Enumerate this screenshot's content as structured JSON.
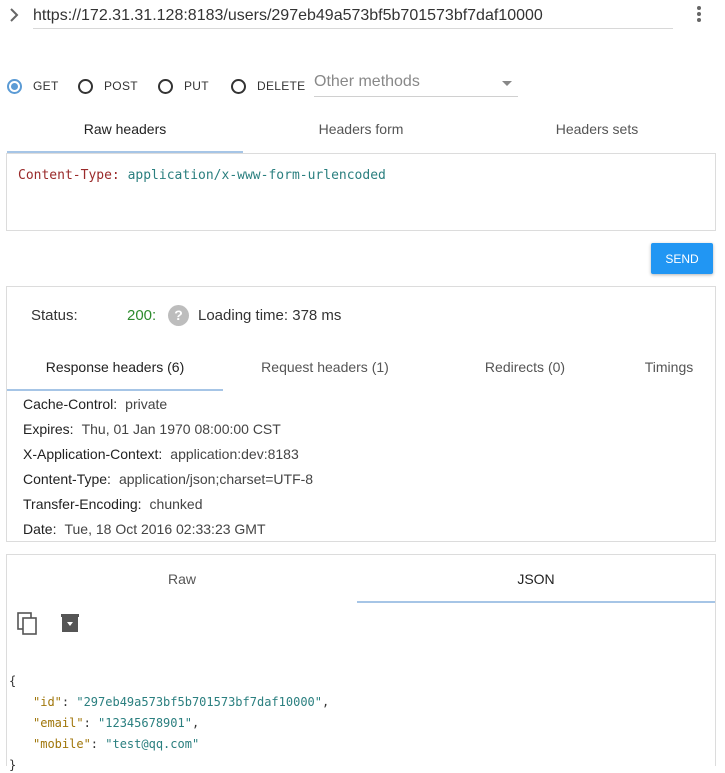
{
  "url": {
    "value": "https://172.31.31.128:8183/users/297eb49a573bf5b701573bf7daf10000"
  },
  "methods": {
    "options": [
      "GET",
      "POST",
      "PUT",
      "DELETE"
    ],
    "selected": "GET",
    "other_placeholder": "Other methods"
  },
  "header_tabs": [
    "Raw headers",
    "Headers form",
    "Headers sets"
  ],
  "raw_headers": {
    "key": "Content-Type:",
    "value": "application/x-www-form-urlencoded"
  },
  "send_label": "SEND",
  "status": {
    "label": "Status:",
    "code": "200:",
    "loading_time": "Loading time: 378 ms"
  },
  "response_tabs": [
    "Response headers (6)",
    "Request headers (1)",
    "Redirects (0)",
    "Timings"
  ],
  "response_headers": [
    {
      "key": "Cache-Control:",
      "value": "private"
    },
    {
      "key": "Expires:",
      "value": "Thu, 01 Jan 1970 08:00:00 CST"
    },
    {
      "key": "X-Application-Context:",
      "value": "application:dev:8183"
    },
    {
      "key": "Content-Type:",
      "value": "application/json;charset=UTF-8"
    },
    {
      "key": "Transfer-Encoding:",
      "value": "chunked"
    },
    {
      "key": "Date:",
      "value": "Tue, 18 Oct 2016 02:33:23 GMT"
    }
  ],
  "body_tabs": [
    "Raw",
    "JSON"
  ],
  "json_body": {
    "open": "{",
    "close": "}",
    "fields": [
      {
        "key": "\"id\"",
        "value": "\"297eb49a573bf5b701573bf7daf10000\"",
        "sep": ","
      },
      {
        "key": "\"email\"",
        "value": "\"12345678901\"",
        "sep": ","
      },
      {
        "key": "\"mobile\"",
        "value": "\"test@qq.com\"",
        "sep": ""
      }
    ]
  }
}
